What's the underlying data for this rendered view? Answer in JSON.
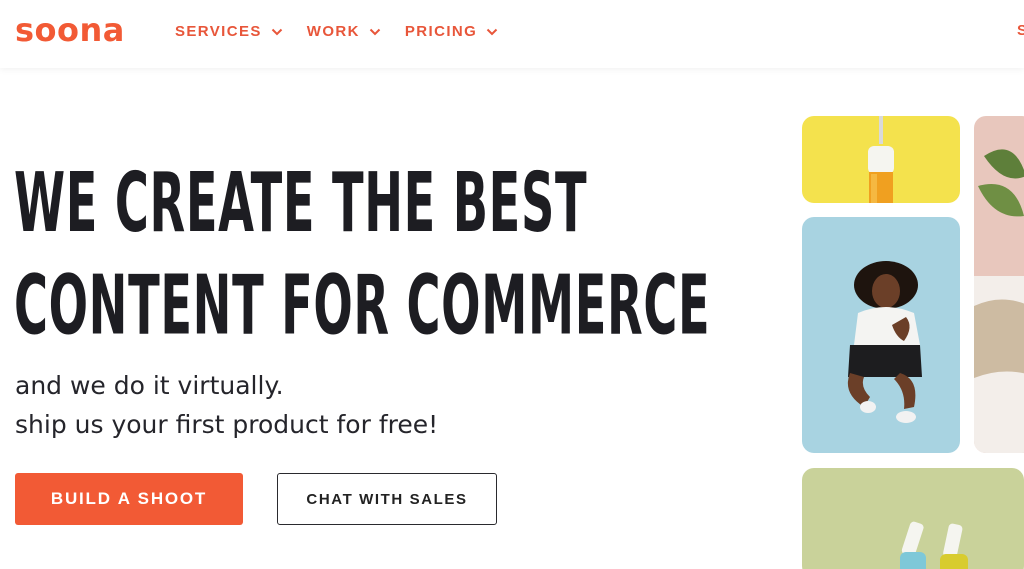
{
  "brand": {
    "logo_text": "soona",
    "accent_color": "#f25a35"
  },
  "nav": {
    "items": [
      {
        "label": "SERVICES"
      },
      {
        "label": "WORK"
      },
      {
        "label": "PRICING"
      }
    ],
    "cut_off_label": "S"
  },
  "hero": {
    "headline_line1": "WE CREATE THE BEST",
    "headline_line2": "CONTENT FOR COMMERCE",
    "sub_line1": "and we do it virtually.",
    "sub_line2": "ship us your first product for free!",
    "primary_button": "BUILD A SHOOT",
    "secondary_button": "CHAT WITH SALES"
  },
  "images": {
    "tile_yellow": {
      "color": "#f4e24d",
      "subject": "serum-dropper-bottle"
    },
    "tile_blue": {
      "color": "#a8d3e1",
      "subject": "smiling-woman-crouching"
    },
    "tile_pink": {
      "color": "#e8c7bd",
      "subject": "plant-and-knit-fabric"
    },
    "tile_green": {
      "color": "#c9d29a",
      "subject": "nail-polish-bottles"
    }
  }
}
